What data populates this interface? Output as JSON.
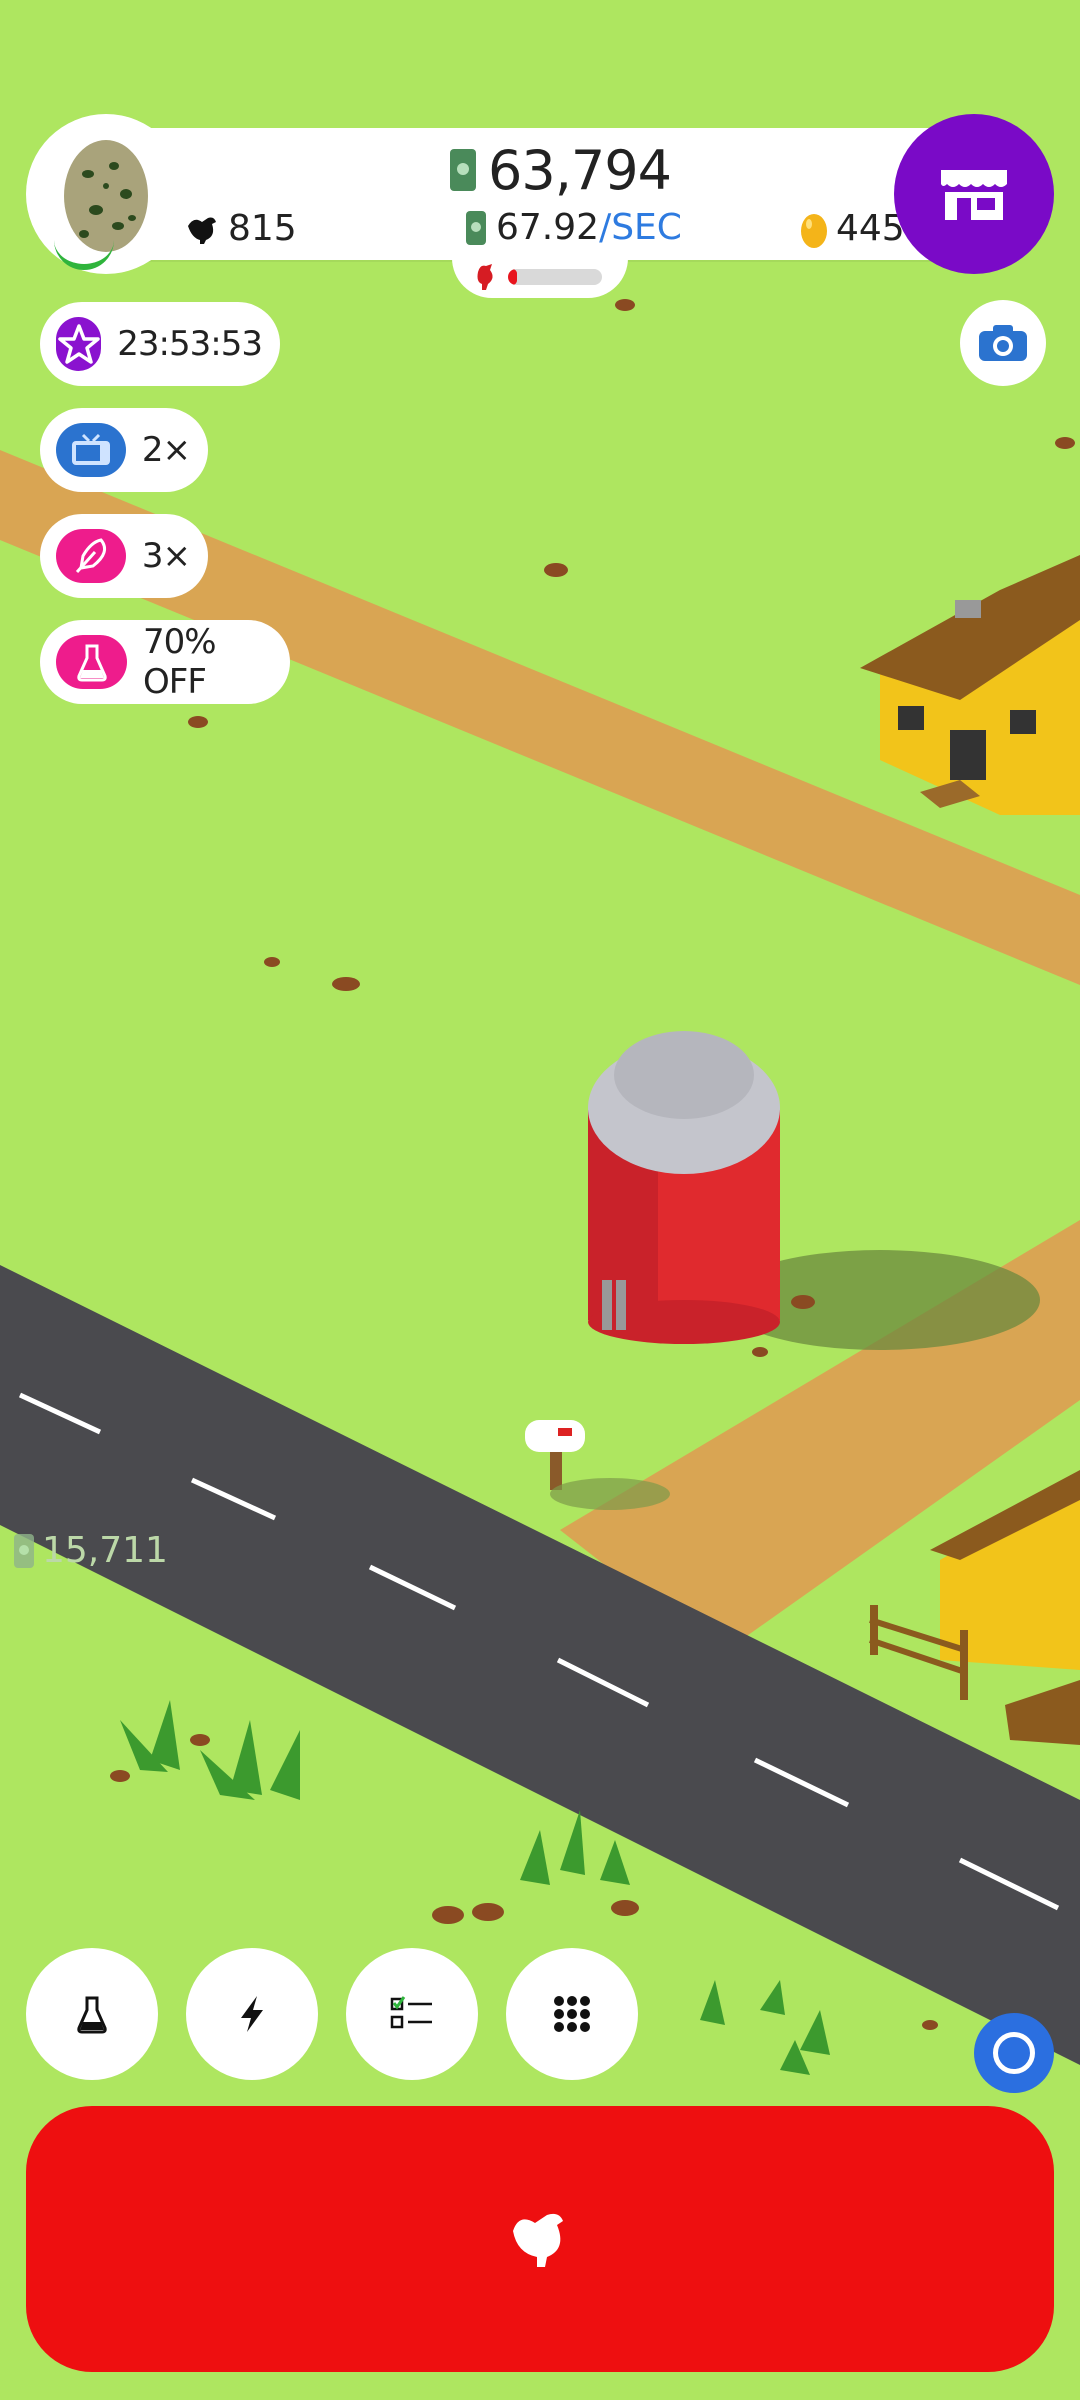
{
  "hud": {
    "money": "63,794",
    "rate_value": "67.92",
    "rate_unit": "/SEC",
    "chickens": "815",
    "golden_eggs": "445",
    "hatch_progress": 0.1
  },
  "boosts": [
    {
      "icon": "star-icon",
      "text": "23:53:53",
      "color": "#8a12cf"
    },
    {
      "icon": "tv-icon",
      "text": "2×",
      "color": "#2b73cf"
    },
    {
      "icon": "feather-icon",
      "text": "3×",
      "color": "#ee1c8c"
    },
    {
      "icon": "flask-icon",
      "text": "70% OFF",
      "color": "#ee1c8c"
    }
  ],
  "floating_income": "15,711",
  "toolbar": [
    "flask-icon",
    "lightning-icon",
    "checklist-icon",
    "grid-icon"
  ],
  "colors": {
    "grass": "#aee660",
    "road": "#4a4a4e",
    "dirt": "#d9a553",
    "shop": "#7a0ac7",
    "hatch": "#ee0f10"
  }
}
